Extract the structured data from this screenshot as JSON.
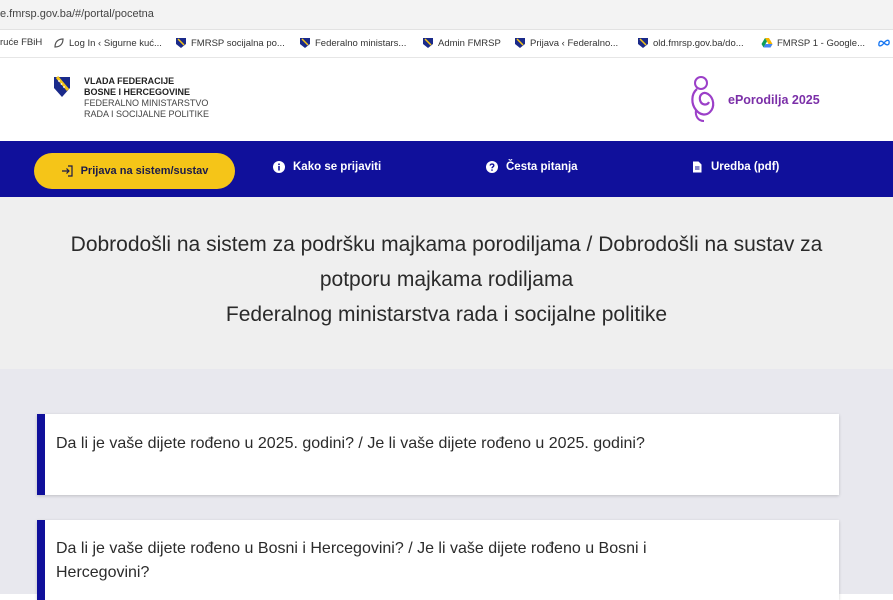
{
  "browser": {
    "url": "e.fmrsp.gov.ba/#/portal/pocetna",
    "bookmarks": [
      "ruće FBiH",
      "Log In ‹ Sigurne kuć...",
      "FMRSP socijalna po...",
      "Federalno ministars...",
      "Admin FMRSP",
      "Prijava ‹ Federalno...",
      "old.fmrsp.gov.ba/do...",
      "FMRSP 1 - Google..."
    ]
  },
  "header": {
    "gov_line1": "VLADA FEDERACIJE",
    "gov_line2": "BOSNE I HERCEGOVINE",
    "gov_line3": "FEDERALNO MINISTARSTVO",
    "gov_line4": "RADA I SOCIJALNE POLITIKE",
    "brand": "ePorodilja 2025"
  },
  "nav": {
    "login": "Prijava na sistem/sustav",
    "how_to": "Kako se prijaviti",
    "faq": "Česta pitanja",
    "regulation": "Uredba (pdf)"
  },
  "welcome": {
    "line1": "Dobrodošli na sistem za podršku majkama porodiljama / Dobrodošli na sustav za",
    "line2": "potporu majkama rodiljama",
    "line3": "Federalnog ministarstva rada i socijalne politike"
  },
  "questions": [
    {
      "line1": "Da li je vaše dijete rođeno u 2025. godini? / Je li vaše dijete rođeno u 2025. godini?"
    },
    {
      "line1": "Da li je vaše dijete rođeno u Bosni i Hercegovini? / Je li vaše dijete rođeno u Bosni i",
      "line2": "Hercegovini?"
    }
  ],
  "colors": {
    "nav_bg": "#10109b",
    "login_bg": "#f5c518",
    "brand": "#7b2fa8"
  }
}
